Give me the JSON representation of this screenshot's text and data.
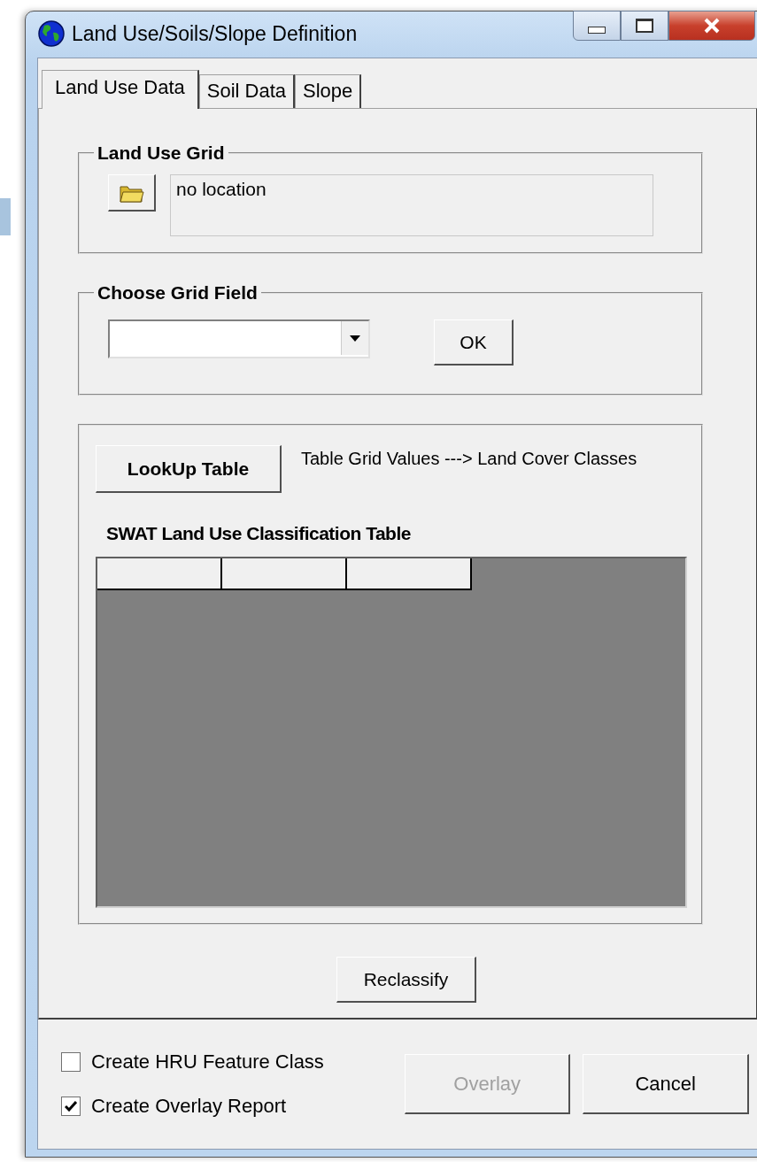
{
  "window": {
    "title": "Land Use/Soils/Slope Definition"
  },
  "tabs": [
    {
      "label": "Land Use Data",
      "selected": true
    },
    {
      "label": "Soil Data",
      "selected": false
    },
    {
      "label": "Slope",
      "selected": false
    }
  ],
  "land_use_grid": {
    "title": "Land Use Grid",
    "location": "no location"
  },
  "choose_grid_field": {
    "title": "Choose Grid Field",
    "ok_button": "OK"
  },
  "lookup": {
    "button": "LookUp Table",
    "note": "Table Grid Values ---> Land Cover Classes"
  },
  "table": {
    "title": "SWAT Land Use Classification Table"
  },
  "reclassify_button": "Reclassify",
  "options": [
    {
      "label": "Create HRU Feature Class",
      "checked": false
    },
    {
      "label": "Create Overlay Report",
      "checked": true
    }
  ],
  "buttons": [
    {
      "label": "Overlay",
      "disabled": true
    },
    {
      "label": "Cancel",
      "disabled": false
    }
  ]
}
